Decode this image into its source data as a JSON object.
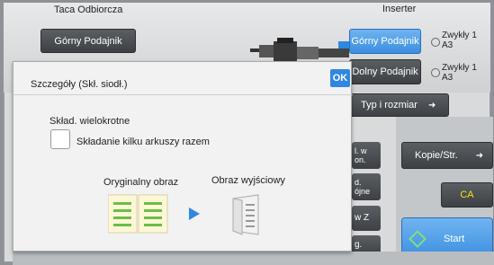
{
  "output_tray": {
    "title": "Taca Odbiorcza",
    "selected": "Górny Podajnik"
  },
  "inserter": {
    "title": "Inserter",
    "upper_tray": {
      "label": "Górny Podajnik",
      "paper_type": "Zwykły 1",
      "paper_size": "A3"
    },
    "lower_tray": {
      "label": "Dolny Podajnik",
      "paper_type": "Zwykły 1",
      "paper_size": "A3"
    },
    "type_size_button": "Typ i rozmiar"
  },
  "background_buttons": {
    "btn1_line1": "l. w",
    "btn1_line2": "on.",
    "btn2_line1": "d.",
    "btn2_line2": "ójne",
    "btn3": "w Z",
    "btn4": "g."
  },
  "right_panel": {
    "copies_per_sheet": "Kopie/Str.",
    "ca": "CA",
    "start": "Start"
  },
  "dialog": {
    "title": "Szczegóły (Skł. siodł.)",
    "ok": "OK",
    "section_label": "Skład. wielokrotne",
    "checkbox_label": "Składanie kilku arkuszy razem",
    "checkbox_checked": false,
    "original_label": "Oryginalny obraz",
    "output_label": "Obraz wyjściowy"
  },
  "colors": {
    "accent_blue": "#2f88e0",
    "ca_yellow": "#f5e418",
    "arrow_blue": "#2f88e0"
  }
}
